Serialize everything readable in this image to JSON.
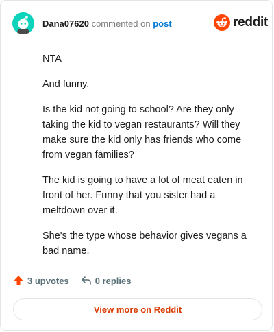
{
  "comment": {
    "username": "Dana07620",
    "action_text": "commented on",
    "post_link_text": "post",
    "paragraphs": [
      "NTA",
      "And funny.",
      "Is the kid not going to school? Are they only taking the kid to vegan restaurants? Will they make sure the kid only has friends who come from vegan families?",
      "The kid is going to have a lot of meat eaten in front of her. Funny that you sister had a meltdown over it.",
      "She's the type whose behavior gives vegans a bad name."
    ]
  },
  "brand": {
    "wordmark": "reddit",
    "color": "#ff4500"
  },
  "avatar": {
    "icon": "snoo-avatar-icon",
    "background": "#0dd3bb"
  },
  "footer": {
    "upvotes": "3 upvotes",
    "replies": "0 replies",
    "upvote_icon": "upvote-arrow-icon",
    "reply_icon": "reply-arrow-icon",
    "upvote_color": "#ff4500"
  },
  "cta": {
    "label": "View more on Reddit",
    "color": "#d93a00"
  }
}
